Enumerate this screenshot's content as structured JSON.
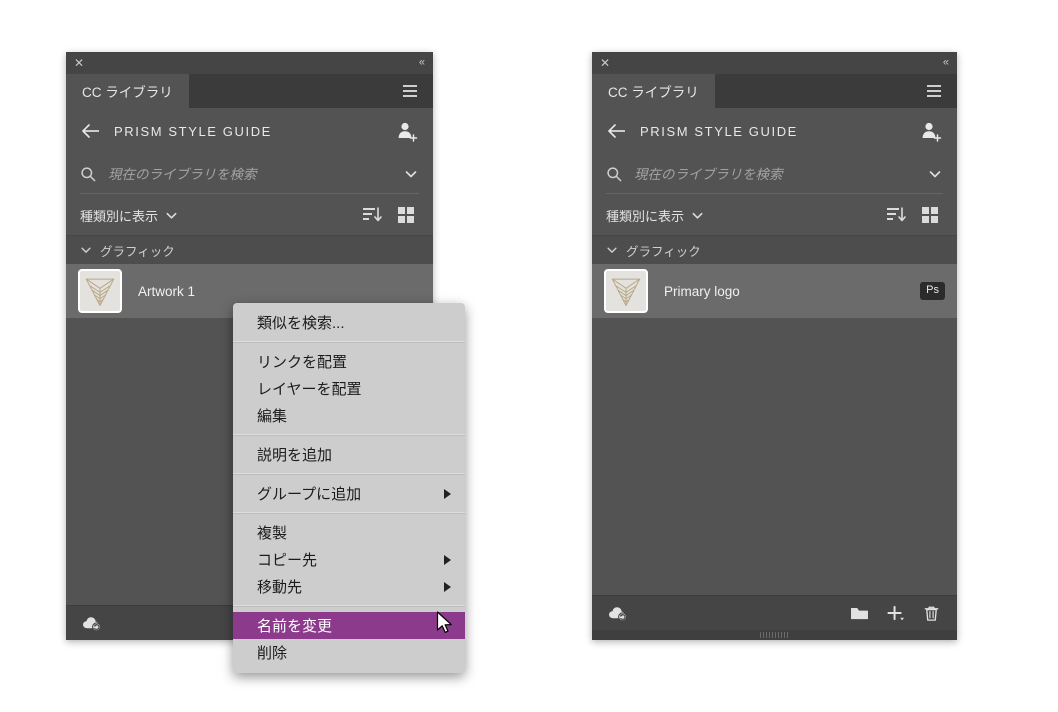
{
  "panels": [
    {
      "id": "left",
      "titlebar": {
        "close": "✕",
        "collapse": "«"
      },
      "tab": {
        "label": "CC ライブラリ"
      },
      "library": {
        "title": "PRISM STYLE GUIDE",
        "back_icon": "arrow-left-icon",
        "invite_icon": "add-collaborator-icon"
      },
      "search": {
        "placeholder": "現在のライブラリを検索",
        "value": "",
        "icon": "search-icon",
        "chevron": "chevron-down-icon"
      },
      "filter": {
        "label": "種類別に表示",
        "chevron": "chevron-down-icon",
        "sort_icon": "sort-descending-icon",
        "grid_icon": "grid-view-icon"
      },
      "group": {
        "label": "グラフィック",
        "chevron": "chevron-down-icon"
      },
      "asset": {
        "name": "Artwork 1",
        "badge": ""
      },
      "footer": {
        "sync_icon": "cloud-sync-icon",
        "actions": []
      }
    },
    {
      "id": "right",
      "titlebar": {
        "close": "✕",
        "collapse": "«"
      },
      "tab": {
        "label": "CC ライブラリ"
      },
      "library": {
        "title": "PRISM STYLE GUIDE",
        "back_icon": "arrow-left-icon",
        "invite_icon": "add-collaborator-icon"
      },
      "search": {
        "placeholder": "現在のライブラリを検索",
        "value": "",
        "icon": "search-icon",
        "chevron": "chevron-down-icon"
      },
      "filter": {
        "label": "種類別に表示",
        "chevron": "chevron-down-icon",
        "sort_icon": "sort-descending-icon",
        "grid_icon": "grid-view-icon"
      },
      "group": {
        "label": "グラフィック",
        "chevron": "chevron-down-icon"
      },
      "asset": {
        "name": "Primary logo",
        "badge": "Ps"
      },
      "footer": {
        "sync_icon": "cloud-sync-icon",
        "actions": [
          "new-group-icon",
          "add-content-icon",
          "delete-icon"
        ]
      }
    }
  ],
  "context_menu": {
    "items": [
      {
        "label": "類似を検索...",
        "submenu": false,
        "selected": false
      },
      {
        "separator": true
      },
      {
        "label": "リンクを配置",
        "submenu": false,
        "selected": false
      },
      {
        "label": "レイヤーを配置",
        "submenu": false,
        "selected": false
      },
      {
        "label": "編集",
        "submenu": false,
        "selected": false
      },
      {
        "separator": true
      },
      {
        "label": "説明を追加",
        "submenu": false,
        "selected": false
      },
      {
        "separator": true
      },
      {
        "label": "グループに追加",
        "submenu": true,
        "selected": false
      },
      {
        "separator": true
      },
      {
        "label": "複製",
        "submenu": false,
        "selected": false
      },
      {
        "label": "コピー先",
        "submenu": true,
        "selected": false
      },
      {
        "label": "移動先",
        "submenu": true,
        "selected": false
      },
      {
        "separator": true
      },
      {
        "label": "名前を変更",
        "submenu": false,
        "selected": true
      },
      {
        "label": "削除",
        "submenu": false,
        "selected": false
      }
    ]
  },
  "colors": {
    "panel_bg": "#535353",
    "titlebar_bg": "#454545",
    "tabstrip_bg": "#3b3b3b",
    "row_selected": "#6b6b6b",
    "menu_bg": "#cdcdcd",
    "menu_highlight": "#8c3a8c",
    "badge_bg": "#2b2b2b",
    "logo_tan": "#bfae92"
  }
}
